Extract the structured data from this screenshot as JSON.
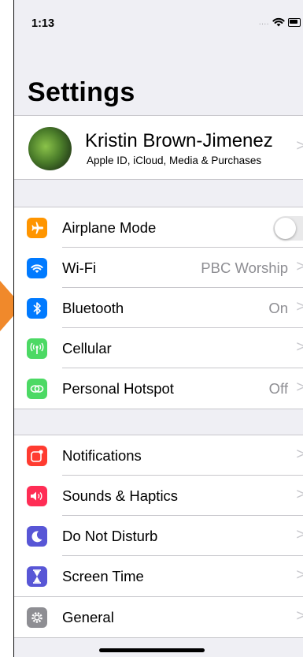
{
  "status_bar": {
    "time": "1:13",
    "signal": "....",
    "icons": [
      "wifi-icon",
      "battery-icon"
    ]
  },
  "page": {
    "title": "Settings"
  },
  "profile": {
    "name": "Kristin Brown-Jimenez",
    "subtitle": "Apple ID, iCloud, Media & Purchases"
  },
  "group1": {
    "items": [
      {
        "label": "Airplane Mode",
        "icon": "airplane-icon",
        "color": "#ff9500",
        "toggle_on": false
      },
      {
        "label": "Wi-Fi",
        "value": "PBC Worship",
        "icon": "wifi-icon",
        "color": "#007aff"
      },
      {
        "label": "Bluetooth",
        "value": "On",
        "icon": "bluetooth-icon",
        "color": "#007aff"
      },
      {
        "label": "Cellular",
        "icon": "antenna-icon",
        "color": "#4cd964"
      },
      {
        "label": "Personal Hotspot",
        "value": "Off",
        "icon": "hotspot-icon",
        "color": "#4cd964"
      }
    ]
  },
  "group2": {
    "items": [
      {
        "label": "Notifications",
        "icon": "notifications-icon",
        "color": "#ff3b30"
      },
      {
        "label": "Sounds & Haptics",
        "icon": "speaker-icon",
        "color": "#ff2d55"
      },
      {
        "label": "Do Not Disturb",
        "icon": "moon-icon",
        "color": "#5856d6"
      },
      {
        "label": "Screen Time",
        "icon": "hourglass-icon",
        "color": "#5856d6"
      }
    ]
  },
  "group3": {
    "items": [
      {
        "label": "General",
        "icon": "gear-icon",
        "color": "#8e8e93"
      }
    ]
  },
  "chevron": ">",
  "pointer_color": "#f0892b"
}
